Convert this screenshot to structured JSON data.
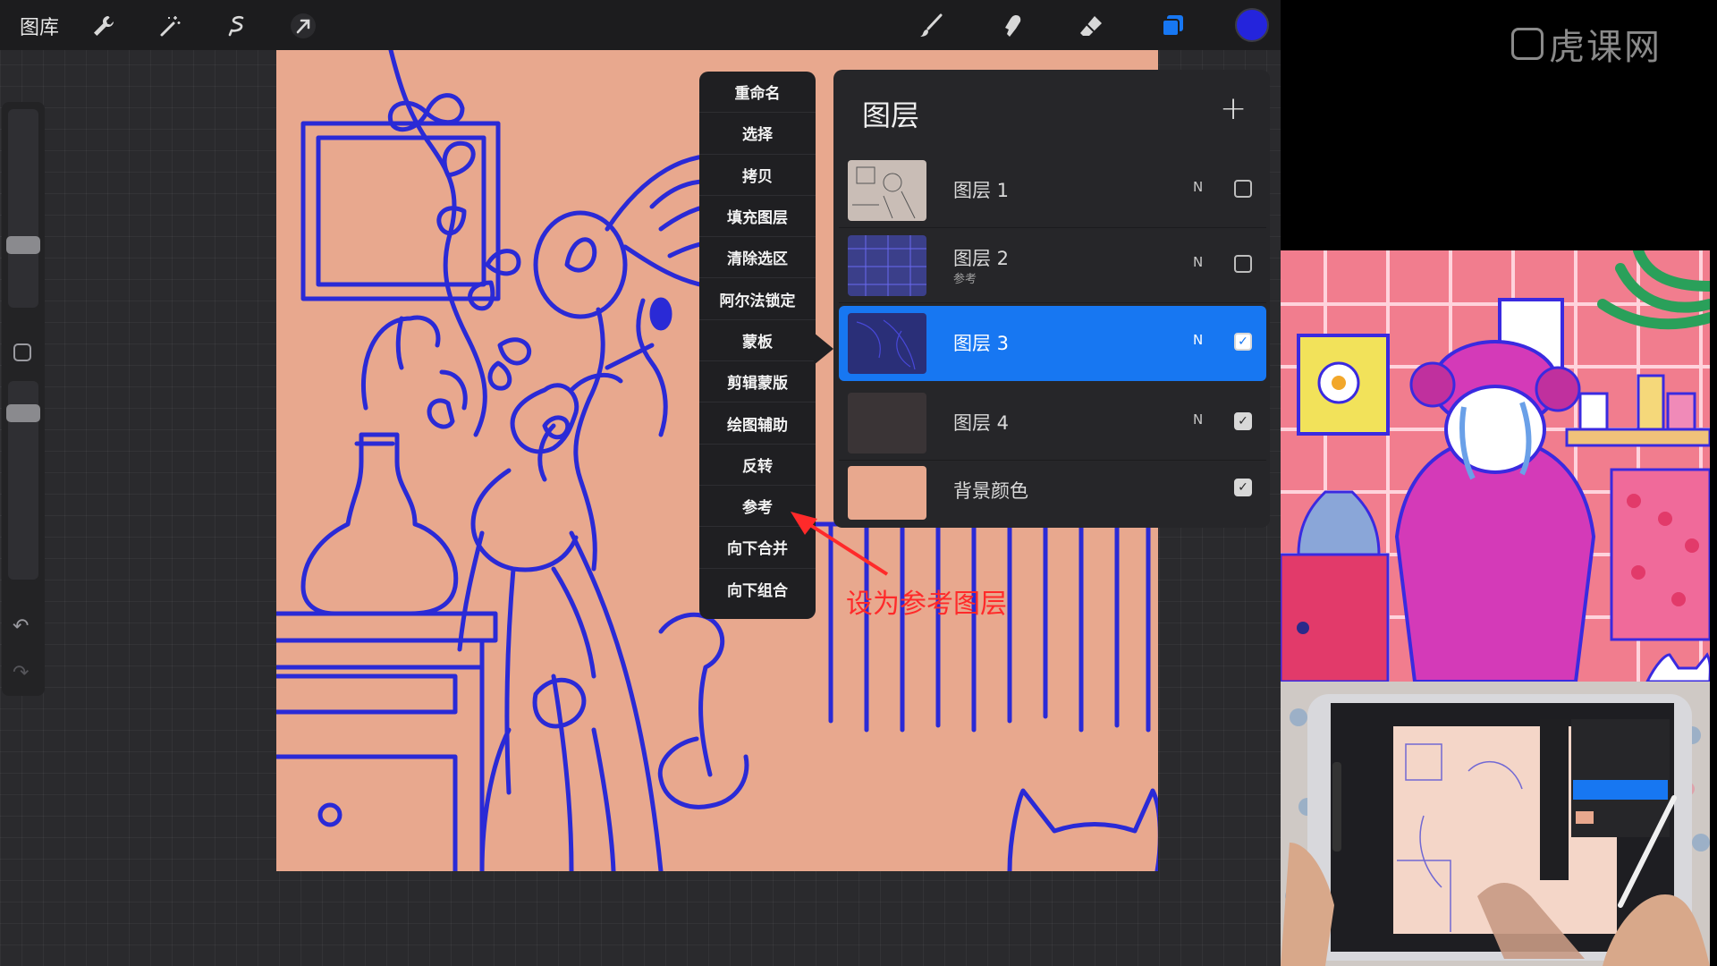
{
  "toolbar": {
    "gallery_label": "图库",
    "left_tools": [
      "wrench-icon",
      "magic-wand-icon",
      "selection-icon",
      "transform-arrow-icon"
    ],
    "right_tools": [
      "brush-icon",
      "smudge-icon",
      "eraser-icon",
      "layers-icon"
    ],
    "current_color": "#2424dc"
  },
  "context_menu": {
    "items": [
      "重命名",
      "选择",
      "拷贝",
      "填充图层",
      "清除选区",
      "阿尔法锁定",
      "蒙板",
      "剪辑蒙版",
      "绘图辅助",
      "反转",
      "参考",
      "向下合并",
      "向下组合"
    ]
  },
  "layers_panel": {
    "title": "图层",
    "add_icon": "plus-icon",
    "layers": [
      {
        "name": "图层 1",
        "subtitle": "",
        "blend": "N",
        "visible": false,
        "selected": false
      },
      {
        "name": "图层 2",
        "subtitle": "参考",
        "blend": "N",
        "visible": false,
        "selected": false
      },
      {
        "name": "图层 3",
        "subtitle": "",
        "blend": "N",
        "visible": true,
        "selected": true
      },
      {
        "name": "图层 4",
        "subtitle": "",
        "blend": "N",
        "visible": true,
        "selected": false
      },
      {
        "name": "背景颜色",
        "subtitle": "",
        "blend": "",
        "visible": true,
        "selected": false
      }
    ]
  },
  "annotation": {
    "text": "设为参考图层",
    "color": "#ff2a2a"
  },
  "watermark": {
    "text": "虎课网"
  },
  "colors": {
    "canvas_bg": "#e8a88e",
    "line_art": "#2a2ad6",
    "accent_blue": "#1777f2"
  }
}
